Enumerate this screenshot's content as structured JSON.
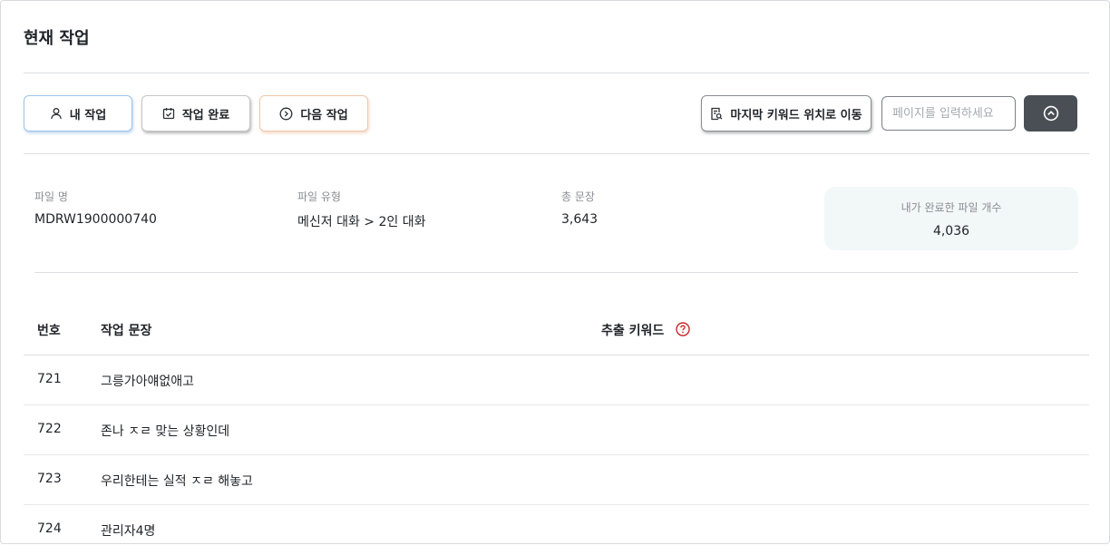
{
  "page": {
    "title": "현재 작업"
  },
  "toolbar": {
    "my_work_label": "내 작업",
    "complete_label": "작업 완료",
    "next_label": "다음 작업",
    "last_keyword_label": "마지막 키워드 위치로 이동",
    "page_input_placeholder": "페이지를 입력하세요",
    "page_input_value": ""
  },
  "file_info": {
    "name_label": "파일 명",
    "name_value": "MDRW1900000740",
    "type_label": "파일 유형",
    "type_value": "메신저 대화 > 2인 대화",
    "total_label": "총 문장",
    "total_value": "3,643",
    "completed_label": "내가 완료한 파일 개수",
    "completed_value": "4,036"
  },
  "table": {
    "columns": [
      "번호",
      "작업 문장",
      "추출 키워드"
    ],
    "rows": [
      {
        "num": "721",
        "text": "그릉가아얘없애고",
        "keyword": ""
      },
      {
        "num": "722",
        "text": "존나 ㅈㄹ 맞는 상황인데",
        "keyword": ""
      },
      {
        "num": "723",
        "text": "우리한테는 실적 ㅈㄹ 해놓고",
        "keyword": ""
      },
      {
        "num": "724",
        "text": "관리자4명",
        "keyword": ""
      }
    ]
  },
  "colors": {
    "accent_blue": "#9cc3ea",
    "accent_orange": "#efc7aa",
    "dark_button": "#4a4f55",
    "help_red": "#c62828",
    "card_bg": "#f2f7f8"
  },
  "icons": {
    "my_work": "person-icon",
    "complete": "calendar-check-icon",
    "next": "circle-arrow-right-icon",
    "last_keyword": "document-search-icon",
    "up": "circle-chevron-up-icon",
    "help": "question-circle-icon"
  }
}
